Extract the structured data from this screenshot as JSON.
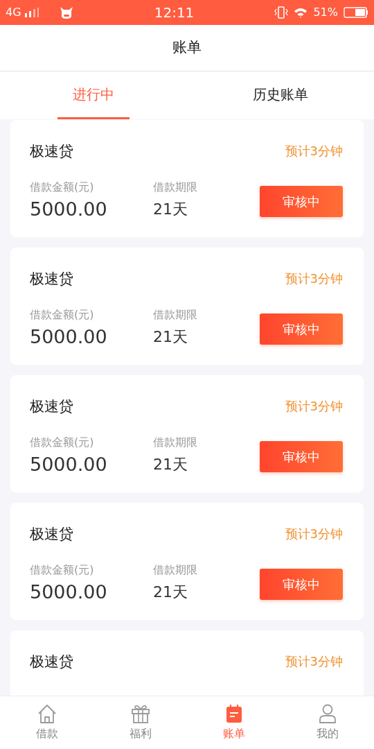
{
  "status_bar": {
    "network": "4G",
    "time": "12:11",
    "battery": "51%"
  },
  "header": {
    "title": "账单"
  },
  "tabs": [
    {
      "label": "进行中",
      "selected": true
    },
    {
      "label": "历史账单",
      "selected": false
    }
  ],
  "loans": [
    {
      "title": "极速贷",
      "eta": "预计3分钟",
      "amount_label": "借款金额(元)",
      "amount": "5000.00",
      "term_label": "借款期限",
      "term": "21天",
      "status": "审核中"
    },
    {
      "title": "极速贷",
      "eta": "预计3分钟",
      "amount_label": "借款金额(元)",
      "amount": "5000.00",
      "term_label": "借款期限",
      "term": "21天",
      "status": "审核中"
    },
    {
      "title": "极速贷",
      "eta": "预计3分钟",
      "amount_label": "借款金额(元)",
      "amount": "5000.00",
      "term_label": "借款期限",
      "term": "21天",
      "status": "审核中"
    },
    {
      "title": "极速贷",
      "eta": "预计3分钟",
      "amount_label": "借款金额(元)",
      "amount": "5000.00",
      "term_label": "借款期限",
      "term": "21天",
      "status": "审核中"
    },
    {
      "title": "极速贷",
      "eta": "预计3分钟"
    }
  ],
  "bottom_nav": [
    {
      "kind": "home",
      "label": "借款",
      "selected": false
    },
    {
      "kind": "gift",
      "label": "福利",
      "selected": false
    },
    {
      "kind": "bill",
      "label": "账单",
      "selected": true
    },
    {
      "kind": "profile",
      "label": "我的",
      "selected": false
    }
  ]
}
